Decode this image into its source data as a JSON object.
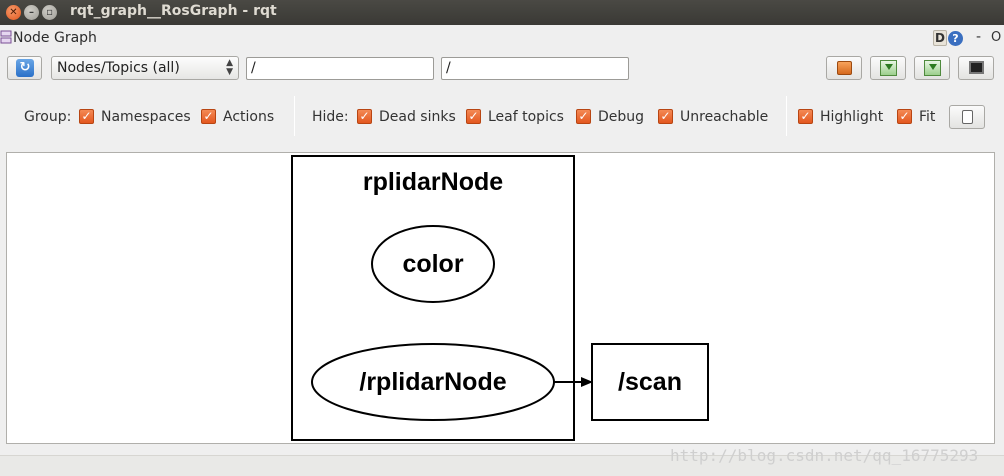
{
  "window": {
    "title": "rqt_graph__RosGraph - rqt"
  },
  "plugin": {
    "title": "Node Graph",
    "d_label": "D",
    "help_label": "?",
    "minimize_label": "-",
    "close_label": "O"
  },
  "toolbar": {
    "graph_type": "Nodes/Topics (all)",
    "node_filter": "/",
    "topic_filter": "/"
  },
  "options": {
    "group_label": "Group:",
    "hide_label": "Hide:",
    "namespaces": "Namespaces",
    "actions": "Actions",
    "dead_sinks": "Dead sinks",
    "leaf_topics": "Leaf topics",
    "debug": "Debug",
    "unreachable": "Unreachable",
    "highlight": "Highlight",
    "fit": "Fit"
  },
  "checked": {
    "namespaces": true,
    "actions": true,
    "dead_sinks": true,
    "leaf_topics": true,
    "debug": true,
    "unreachable": true,
    "highlight": true,
    "fit": true
  },
  "graph": {
    "cluster_label": "rplidarNode",
    "node_color": "color",
    "node_rplidar": "/rplidarNode",
    "topic_scan": "/scan"
  },
  "watermark": "http://blog.csdn.net/qq_16775293"
}
